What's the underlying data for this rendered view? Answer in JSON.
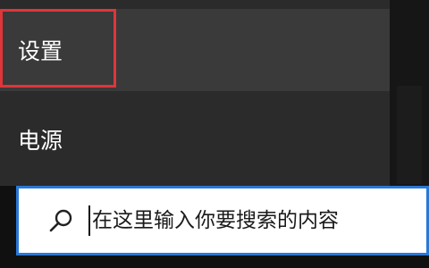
{
  "start_menu": {
    "items": [
      {
        "label": "设置",
        "icon": "gear-icon"
      },
      {
        "label": "电源",
        "icon": "power-icon"
      }
    ]
  },
  "taskbar": {
    "search": {
      "placeholder": "在这里输入你要搜索的内容",
      "value": "",
      "icon": "search-icon"
    }
  },
  "colors": {
    "highlight_border": "#e0353a",
    "search_focus_border": "#2a78d6",
    "menu_background": "#2b2b2b",
    "selected_item_background": "#3a3a3a"
  }
}
